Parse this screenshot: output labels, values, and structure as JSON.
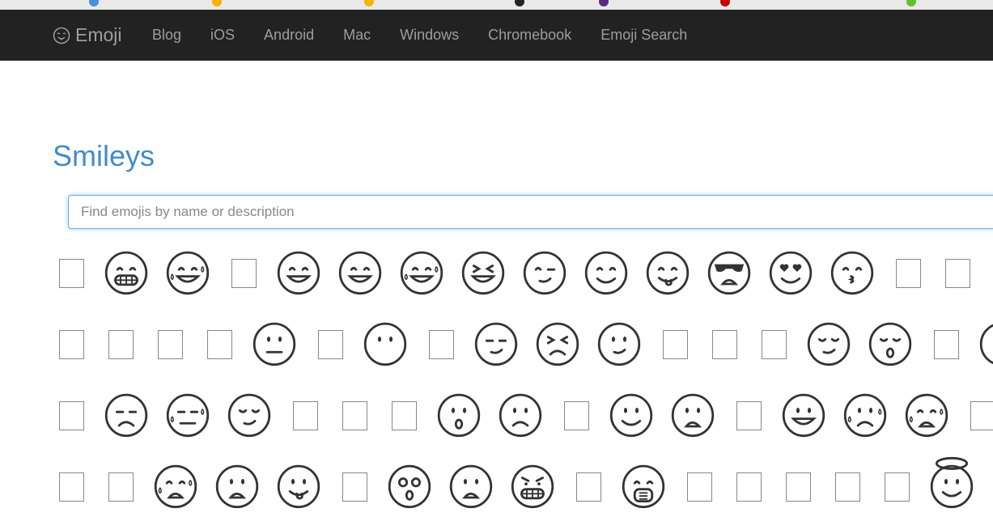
{
  "nav": {
    "brand": "Emoji",
    "links": [
      "Blog",
      "iOS",
      "Android",
      "Mac",
      "Windows",
      "Chromebook",
      "Emoji Search"
    ]
  },
  "page_title": "Smileys",
  "search": {
    "placeholder": "Find emojis by name or description",
    "value": ""
  },
  "colors": {
    "nav_bg": "#222222",
    "nav_text": "#9d9d9d",
    "title": "#428bca",
    "focus_border": "#66afe9"
  },
  "grid": [
    [
      "tofu",
      "grin-teeth",
      "joy",
      "tofu",
      "smile-open",
      "smile-open",
      "sweat-smile",
      "laughing",
      "wink",
      "smile",
      "yum",
      "sunglasses",
      "heart-eyes",
      "kiss",
      "tofu",
      "tofu"
    ],
    [
      "tofu",
      "tofu",
      "tofu",
      "tofu",
      "neutral",
      "tofu",
      "no-mouth",
      "tofu",
      "smirk",
      "persevere",
      "thinking-up",
      "tofu",
      "tofu",
      "tofu",
      "relieved",
      "sleepy",
      "tofu",
      "sweat-drop"
    ],
    [
      "tofu",
      "unamused",
      "sweat",
      "pensive",
      "tofu",
      "tofu",
      "tofu",
      "open-mouth",
      "frowning",
      "tofu",
      "silly",
      "anguished",
      "tofu",
      "grin-big",
      "cry",
      "sob",
      "tofu"
    ],
    [
      "tofu",
      "tofu",
      "scream",
      "fearful",
      "tongue",
      "tofu",
      "dizzy",
      "worried",
      "angry-teeth",
      "tofu",
      "mask",
      "tofu",
      "tofu",
      "tofu",
      "tofu",
      "tofu",
      "halo"
    ]
  ]
}
